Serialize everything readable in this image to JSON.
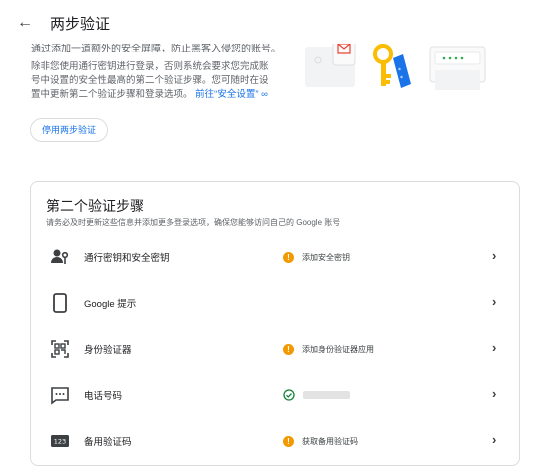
{
  "header": {
    "back_icon": "arrow-back-icon",
    "title": "两步验证"
  },
  "intro": {
    "cut_line": "通过添加一道额外的安全屏障，防止黑客入侵您的账号。",
    "paragraph": "除非您使用通行密钥进行登录，否则系统会要求您完成账号中设置的安全性最高的第二个验证步骤。您可随时在设置中更新第二个验证步骤和登录选项。",
    "link": "前往“安全设置”"
  },
  "disable_button": "停用两步验证",
  "second_step": {
    "title": "第二个验证步骤",
    "subtitle": "请务必及时更新这些信息并添加更多登录选项，确保您能够访问自己的 Google 账号",
    "rows": [
      {
        "icon": "passkey-icon",
        "label": "通行密钥和安全密钥",
        "status_type": "warning",
        "status": "添加安全密钥"
      },
      {
        "icon": "phone-prompt-icon",
        "label": "Google 提示",
        "status_type": "none",
        "status": ""
      },
      {
        "icon": "authenticator-icon",
        "label": "身份验证器",
        "status_type": "warning",
        "status": "添加身份验证器应用"
      },
      {
        "icon": "sms-icon",
        "label": "电话号码",
        "status_type": "ok",
        "status": ""
      },
      {
        "icon": "backup-codes-icon",
        "label": "备用验证码",
        "status_type": "warning",
        "status": "获取备用验证码"
      }
    ]
  },
  "colors": {
    "accent": "#1a73e8",
    "warning": "#f29900",
    "ok": "#188038"
  }
}
